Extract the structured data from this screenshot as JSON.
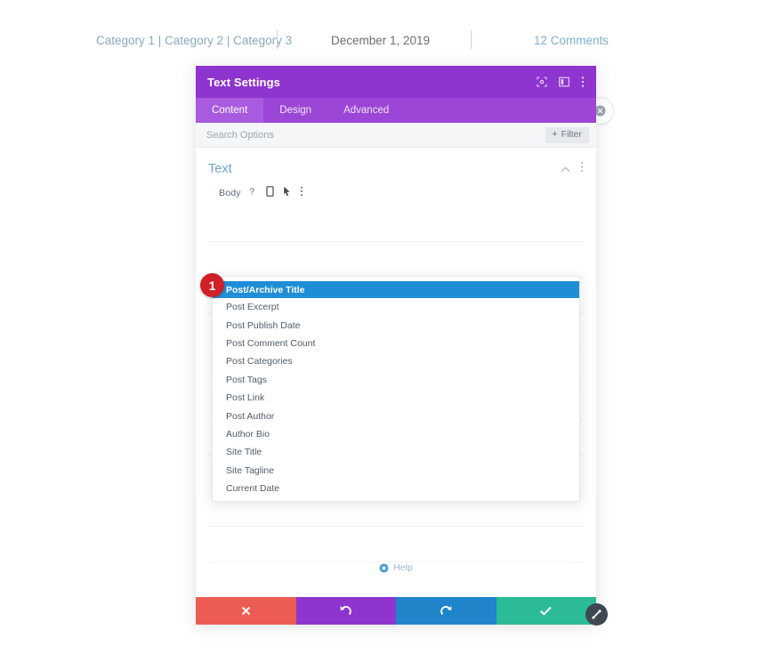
{
  "post_meta": {
    "categories": "Category 1 | Category 2 | Category 3",
    "date": "December 1, 2019",
    "comments": "12 Comments",
    "link_color": "#8ba8bd"
  },
  "modal": {
    "title": "Text Settings",
    "titlebar_color": "#8e34cf",
    "titlebar_icons": [
      {
        "name": "expand-icon"
      },
      {
        "name": "panel-layout-icon"
      },
      {
        "name": "more-vertical-icon"
      }
    ],
    "tabs": [
      {
        "label": "Content",
        "active": true
      },
      {
        "label": "Design",
        "active": false
      },
      {
        "label": "Advanced",
        "active": false
      }
    ],
    "search": {
      "placeholder": "Search Options",
      "filter_label": "Filter",
      "filter_plus": "+"
    },
    "section": {
      "title": "Text",
      "collapse_icon": "chevron-up-icon",
      "more_icon": "more-vertical-icon"
    },
    "field": {
      "label": "Body",
      "icons": [
        {
          "name": "help-question-icon"
        },
        {
          "name": "responsive-mobile-icon"
        },
        {
          "name": "hover-cursor-icon"
        },
        {
          "name": "more-vertical-icon"
        }
      ]
    },
    "help": {
      "label": "Help",
      "icon": "lifesaver-icon"
    },
    "dropdown": {
      "badge": "1",
      "badge_color": "#cf1f27",
      "selected_color": "#1f8ed6",
      "selected_index": 0,
      "options": [
        "Post/Archive Title",
        "Post Excerpt",
        "Post Publish Date",
        "Post Comment Count",
        "Post Categories",
        "Post Tags",
        "Post Link",
        "Post Author",
        "Author Bio",
        "Site Title",
        "Site Tagline",
        "Current Date"
      ]
    },
    "footer": [
      {
        "name": "cancel-button",
        "icon": "close-icon",
        "color": "#ec5c54"
      },
      {
        "name": "undo-button",
        "icon": "undo-icon",
        "color": "#8e34cf"
      },
      {
        "name": "redo-button",
        "icon": "redo-icon",
        "color": "#2084cb"
      },
      {
        "name": "save-button",
        "icon": "check-icon",
        "color": "#2bbb96"
      }
    ]
  }
}
